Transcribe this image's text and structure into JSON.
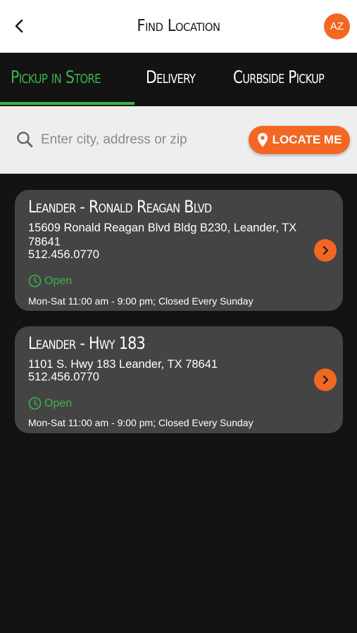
{
  "header": {
    "title": "Find Location",
    "back_icon": "chevron-left-icon",
    "avatar_initials": "AZ"
  },
  "tabs": [
    {
      "label": "Pickup in Store",
      "active": true
    },
    {
      "label": "Delivery",
      "active": false
    },
    {
      "label": "Curbside Pickup",
      "active": false
    }
  ],
  "search": {
    "placeholder": "Enter city, address or zip",
    "value": "",
    "icon": "search-icon",
    "locate_label": "LOCATE ME",
    "locate_icon": "location-pin-icon"
  },
  "locations": [
    {
      "name": "Leander - Ronald Reagan Blvd",
      "address": "15609 Ronald Reagan Blvd Bldg B230, Leander, TX 78641",
      "phone": "512.456.0770",
      "status": "Open",
      "hours": "Mon-Sat 11:00 am - 9:00 pm; Closed Every Sunday"
    },
    {
      "name": "Leander - Hwy 183",
      "address": "1101 S. Hwy 183 Leander, TX 78641",
      "phone": "512.456.0770",
      "status": "Open",
      "hours": "Mon-Sat 11:00 am - 9:00 pm; Closed Every Sunday"
    }
  ],
  "colors": {
    "accent": "#f26722",
    "active_tab": "#3bb64a",
    "background": "#131313",
    "card": "#444444",
    "open_status": "#3bb64a"
  }
}
